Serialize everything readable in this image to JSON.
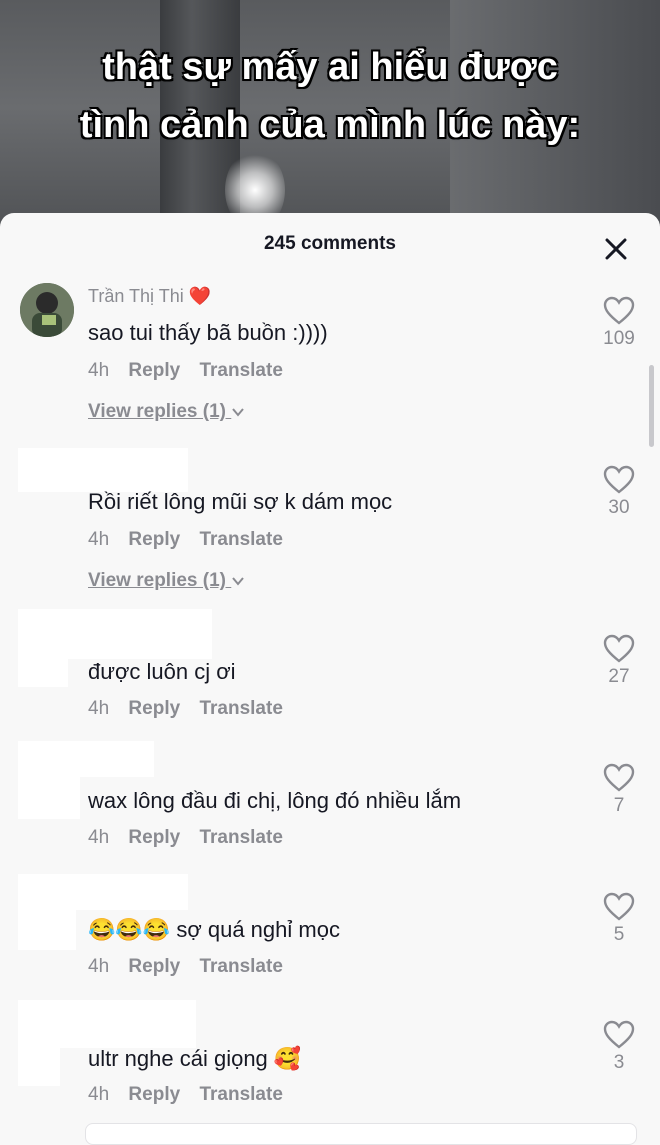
{
  "video": {
    "caption_line1": "thật sự mấy ai hiểu được",
    "caption_line2": "tình cảnh của mình lúc này:"
  },
  "sheet": {
    "title": "245 comments"
  },
  "comments": [
    {
      "username": "Trần Thị Thi",
      "username_emoji": "❤️",
      "text": "sao tui thấy bã buồn :))))",
      "time": "4h",
      "reply": "Reply",
      "translate": "Translate",
      "view_replies": "View replies (1)",
      "likes": "109"
    },
    {
      "text": "Rồi riết lông mũi sợ k dám mọc",
      "time": "4h",
      "reply": "Reply",
      "translate": "Translate",
      "view_replies": "View replies (1)",
      "likes": "30"
    },
    {
      "text": "được luôn cj ơi",
      "time": "4h",
      "reply": "Reply",
      "translate": "Translate",
      "likes": "27"
    },
    {
      "text": "wax lông đầu đi chị, lông đó nhiều lắm",
      "time": "4h",
      "reply": "Reply",
      "translate": "Translate",
      "likes": "7"
    },
    {
      "emoji_prefix": "😂😂😂",
      "text": "sợ quá nghỉ mọc",
      "time": "4h",
      "reply": "Reply",
      "translate": "Translate",
      "likes": "5"
    },
    {
      "text": "ultr nghe cái giọng",
      "emoji_suffix": "🥰",
      "time": "4h",
      "reply": "Reply",
      "translate": "Translate",
      "likes": "3"
    }
  ],
  "icons": {
    "close": "close-icon",
    "like": "heart-outline-icon",
    "chevron": "chevron-down-icon"
  },
  "colors": {
    "heart_accent": "#e8323c",
    "secondary_text": "#8a8b91",
    "primary_text": "#161823"
  }
}
